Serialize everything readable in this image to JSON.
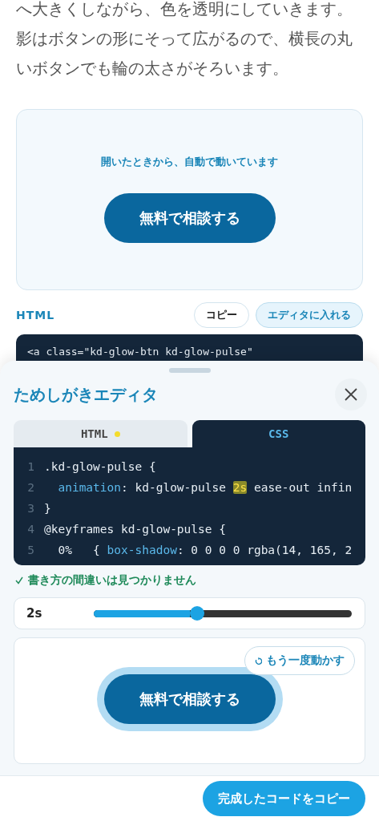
{
  "article": {
    "paragraph": "へ大きくしながら、色を透明にしていきます。影はボタンの形にそって広がるので、横長の丸いボタンでも輪の太さがそろいます。"
  },
  "demo": {
    "caption": "開いたときから、自動で動いています",
    "button": "無料で相談する"
  },
  "code_section": {
    "label": "HTML",
    "buttons": [
      {
        "label": "コピー",
        "kind": "plain"
      },
      {
        "label": "エディタに入れる",
        "kind": "accent"
      }
    ],
    "lines": [
      "<a class=\"kd-glow-btn kd-glow-pulse\""
    ]
  },
  "editor": {
    "title": "ためしがきエディタ",
    "tabs": [
      {
        "label": "HTML",
        "selected": false,
        "modified": true
      },
      {
        "label": "CSS",
        "selected": true,
        "modified": false
      }
    ],
    "lines": [
      {
        "number": "1",
        "tokens": [
          {
            "text": ".kd-glow-pulse {",
            "kind": "plain"
          }
        ]
      },
      {
        "number": "2",
        "indented": true,
        "tokens": [
          {
            "text": "animation",
            "kind": "property"
          },
          {
            "text": ": kd-glow-pulse ",
            "kind": "plain"
          },
          {
            "text": "2s",
            "kind": "highlight"
          },
          {
            "text": " ease-out infin",
            "kind": "plain"
          }
        ]
      },
      {
        "number": "3",
        "tokens": [
          {
            "text": "}",
            "kind": "plain"
          }
        ]
      },
      {
        "number": "4",
        "tokens": [
          {
            "text": "@keyframes kd-glow-pulse {",
            "kind": "plain"
          }
        ]
      },
      {
        "number": "5",
        "indented": true,
        "tokens": [
          {
            "text": "0%   { ",
            "kind": "plain"
          },
          {
            "text": "box-shadow",
            "kind": "property"
          },
          {
            "text": ": 0 0 0 0 rgba(14, 165, 2",
            "kind": "plain"
          }
        ]
      }
    ],
    "status": {
      "text": "書き方の間違いは見つかりません",
      "ok": true
    },
    "slider": {
      "reading": "2s",
      "level": 0.4
    },
    "preview": {
      "replay_button": "もう一度動かす",
      "button": "無料で相談する",
      "glowing": true
    },
    "copy_button": "完成したコードをコピー"
  }
}
